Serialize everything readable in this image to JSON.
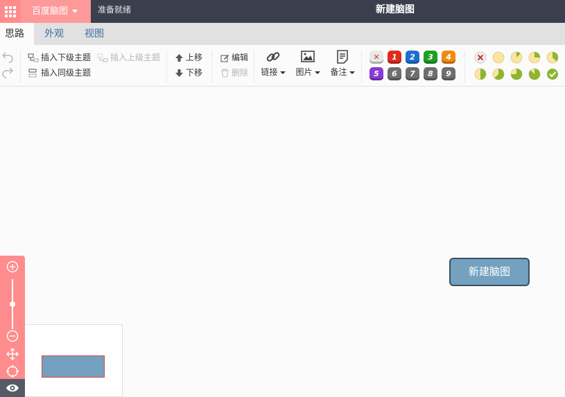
{
  "app": {
    "brand": "百度脑图",
    "status": "准备就绪",
    "doc_title": "新建脑图"
  },
  "tabs": [
    "思路",
    "外观",
    "视图"
  ],
  "toolbar": {
    "insert_child": "插入下级主题",
    "insert_parent": "插入上级主题",
    "insert_sibling": "插入同级主题",
    "move_up": "上移",
    "move_down": "下移",
    "edit": "编辑",
    "delete": "删除",
    "link": "链接",
    "image": "图片",
    "note": "备注"
  },
  "priority": {
    "labels": [
      "1",
      "2",
      "3",
      "4",
      "5",
      "6",
      "7",
      "8",
      "9"
    ],
    "colors": [
      "#e12a1c",
      "#1c6fd1",
      "#1fa022",
      "#f08a13",
      "#8a3ad5",
      "#6e6e6e",
      "#6e6e6e",
      "#6e6e6e",
      "#6e6e6e"
    ]
  },
  "progress": {
    "levels": [
      0,
      0,
      0.125,
      0.25,
      0.375,
      0.5,
      0.625,
      0.75,
      0.875,
      1
    ]
  },
  "mindmap": {
    "root_text": "新建脑图"
  },
  "colors": {
    "topbar": "#3b3f4d",
    "accent": "#fe8c8c",
    "node_fill": "#73a1bf",
    "progress_fill": "#8cb630",
    "progress_bg": "#fbe5a0"
  }
}
